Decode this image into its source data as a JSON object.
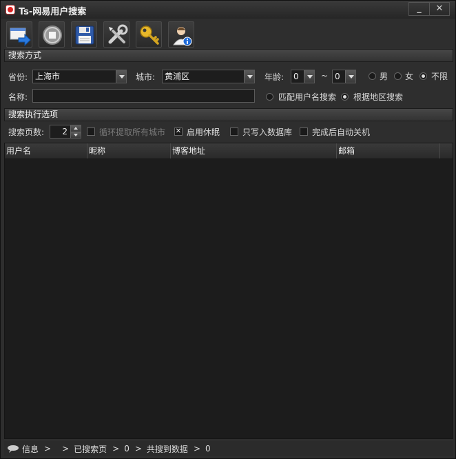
{
  "window": {
    "title": "Ts-网易用户搜索",
    "minimize_glyph": "_",
    "close_glyph": "✕"
  },
  "toolbar": {
    "items": [
      {
        "name": "import-button",
        "icon": "import-arrow-icon"
      },
      {
        "name": "stop-button",
        "icon": "stop-icon"
      },
      {
        "name": "save-button",
        "icon": "floppy-disk-icon"
      },
      {
        "name": "settings-button",
        "icon": "tools-icon"
      },
      {
        "name": "register-button",
        "icon": "key-icon"
      },
      {
        "name": "about-button",
        "icon": "user-info-icon"
      }
    ]
  },
  "search_mode": {
    "section_title": "搜索方式",
    "province_label": "省份:",
    "province_value": "上海市",
    "city_label": "城市:",
    "city_value": "黄浦区",
    "age_label": "年龄:",
    "age_from": "0",
    "age_sep": "~",
    "age_to": "0",
    "gender_male": "男",
    "gender_female": "女",
    "gender_any": "不限",
    "gender_selected": "不限",
    "name_label": "名称:",
    "name_value": "",
    "match_username": "匹配用户名搜索",
    "by_region": "根据地区搜索",
    "mode_selected": "根据地区搜索"
  },
  "exec_options": {
    "section_title": "搜索执行选项",
    "pages_label": "搜索页数:",
    "pages_value": "2",
    "loop_cities": "循环提取所有城市",
    "loop_cities_checked": false,
    "enable_sleep": "启用休眠",
    "enable_sleep_checked": true,
    "db_only": "只写入数据库",
    "db_only_checked": false,
    "auto_shutdown": "完成后自动关机",
    "auto_shutdown_checked": false
  },
  "table": {
    "columns": [
      "用户名",
      "昵称",
      "博客地址",
      "邮箱"
    ],
    "rows": []
  },
  "status": {
    "info_label": "信息",
    "sep1": ">",
    "sep2": ">",
    "searched_pages_label": "已搜索页",
    "sep3": ">",
    "searched_pages_value": "0",
    "sep4": ">",
    "total_data_label": "共搜到数据",
    "sep5": ">",
    "total_data_value": "0"
  }
}
